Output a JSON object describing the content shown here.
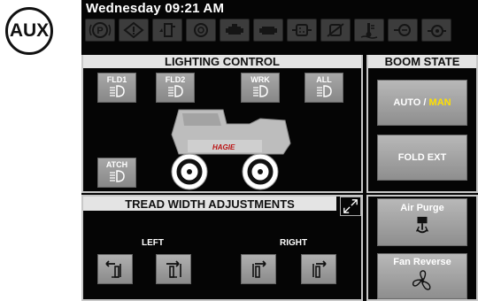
{
  "aux_badge": "AUX",
  "clock": "Wednesday 09:21 AM",
  "warning_lights": [
    {
      "icon": "parking-brake-icon"
    },
    {
      "icon": "warning-triangle-icon"
    },
    {
      "icon": "fuel-water-icon"
    },
    {
      "icon": "transmission-icon"
    },
    {
      "icon": "engine-icon"
    },
    {
      "icon": "engine-check-icon"
    },
    {
      "icon": "exhaust-filter-icon"
    },
    {
      "icon": "exhaust-filter-off-icon"
    },
    {
      "icon": "coolant-temp-icon"
    },
    {
      "icon": "hydraulic-filter-icon"
    },
    {
      "icon": "oil-pressure-icon"
    }
  ],
  "lighting": {
    "title": "LIGHTING CONTROL",
    "buttons": {
      "fld1": "FLD1",
      "fld2": "FLD2",
      "wrk": "WRK",
      "all": "ALL",
      "atch": "ATCH"
    },
    "vehicle_brand": "HAGIE"
  },
  "boom": {
    "title": "BOOM STATE",
    "auto_label": "AUTO",
    "separator": "/",
    "man_label": "MAN",
    "fold_ext_label": "FOLD EXT",
    "accent_color": "#ffe000"
  },
  "tread": {
    "title": "TREAD WIDTH ADJUSTMENTS",
    "left_label": "LEFT",
    "right_label": "RIGHT"
  },
  "air_purge_label": "Air Purge",
  "fan_reverse_label": "Fan Reverse"
}
